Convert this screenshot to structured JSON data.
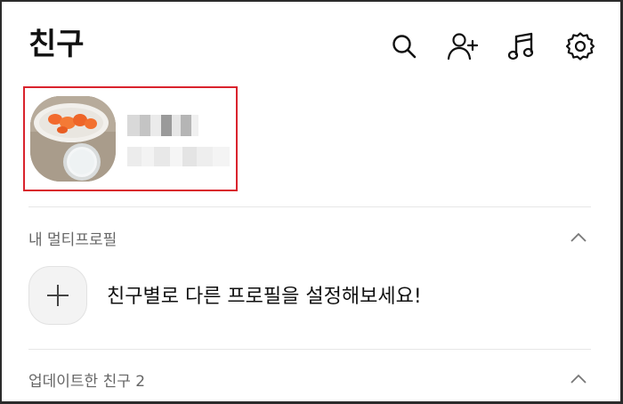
{
  "header": {
    "title": "친구",
    "icons": [
      "search-icon",
      "add-friend-icon",
      "music-icon",
      "settings-icon"
    ]
  },
  "profile": {
    "avatar": "food-photo-avatar",
    "name": "",
    "status": ""
  },
  "multi_profile": {
    "title": "내 멀티프로필",
    "cta_text": "친구별로 다른 프로필을 설정해보세요!"
  },
  "updated_friends": {
    "title": "업데이트한 친구 2"
  },
  "colors": {
    "highlight_border": "#d9232d",
    "divider": "#e6e6e6",
    "text_primary": "#111111",
    "text_secondary": "#666666"
  }
}
